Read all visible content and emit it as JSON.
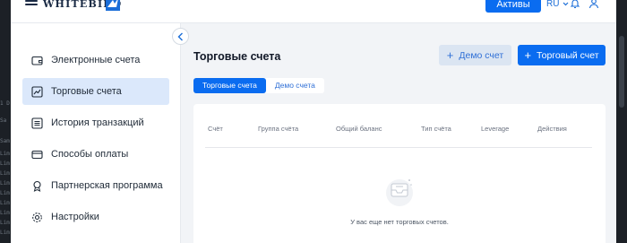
{
  "background_strip": {
    "fragments": [
      "1 D",
      "Sa",
      "Sam",
      "Lim",
      "Lim",
      "Lim",
      "Lim",
      "Lim",
      "Lim",
      "Lim",
      "Lim",
      "Lim"
    ]
  },
  "header": {
    "logo_text": "WHITEBIRD",
    "assets_button": "Активы",
    "language": "RU"
  },
  "sidebar": {
    "items": [
      {
        "label": "Электронные счета",
        "icon": "wallet-icon",
        "active": false
      },
      {
        "label": "Торговые счета",
        "icon": "chart-icon",
        "active": true
      },
      {
        "label": "История транзакций",
        "icon": "history-icon",
        "active": false
      },
      {
        "label": "Способы оплаты",
        "icon": "card-icon",
        "active": false
      },
      {
        "label": "Партнерская программа",
        "icon": "badge-icon",
        "active": false
      },
      {
        "label": "Настройки",
        "icon": "gear-icon",
        "active": false
      }
    ]
  },
  "main": {
    "title": "Торговые счета",
    "demo_button": "Демо счет",
    "trade_button": "Торговый счет",
    "tabs": [
      {
        "label": "Торговые счета",
        "active": true
      },
      {
        "label": "Демо счета",
        "active": false
      }
    ],
    "table": {
      "columns": [
        "Счёт",
        "Группа счёта",
        "Общий баланс",
        "Тип счёта",
        "Leverage",
        "Действия"
      ],
      "empty_text": "У вас еще нет торговых счетов."
    }
  },
  "colors": {
    "accent": "#0a6cf0",
    "active_nav_bg": "#dbe8fb",
    "page_bg": "#f2f4f7"
  }
}
